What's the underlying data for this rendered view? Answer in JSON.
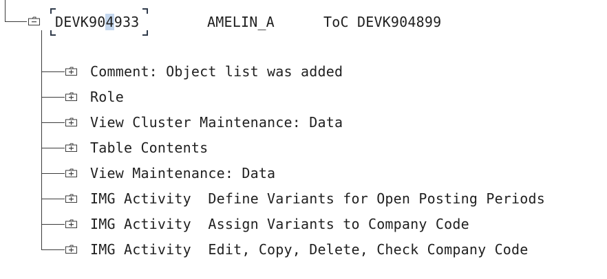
{
  "request": {
    "number_before_cursor": "DEVK90",
    "number_cursor_char": "4",
    "number_after_cursor": "933",
    "owner": "AMELIN_A",
    "description": "ToC DEVK904899",
    "expand_icon": "collapse-box-icon"
  },
  "objects": [
    {
      "label": "Comment: Object list was added",
      "icon": "expand-box-icon"
    },
    {
      "label": "Role",
      "icon": "expand-box-icon"
    },
    {
      "label": "View Cluster Maintenance: Data",
      "icon": "expand-box-icon"
    },
    {
      "label": "Table Contents",
      "icon": "expand-box-icon"
    },
    {
      "label": "View Maintenance: Data",
      "icon": "expand-box-icon"
    },
    {
      "label": "IMG Activity  Define Variants for Open Posting Periods",
      "icon": "expand-box-icon"
    },
    {
      "label": "IMG Activity  Assign Variants to Company Code",
      "icon": "expand-box-icon"
    },
    {
      "label": "IMG Activity  Edit, Copy, Delete, Check Company Code",
      "icon": "expand-box-icon"
    }
  ]
}
